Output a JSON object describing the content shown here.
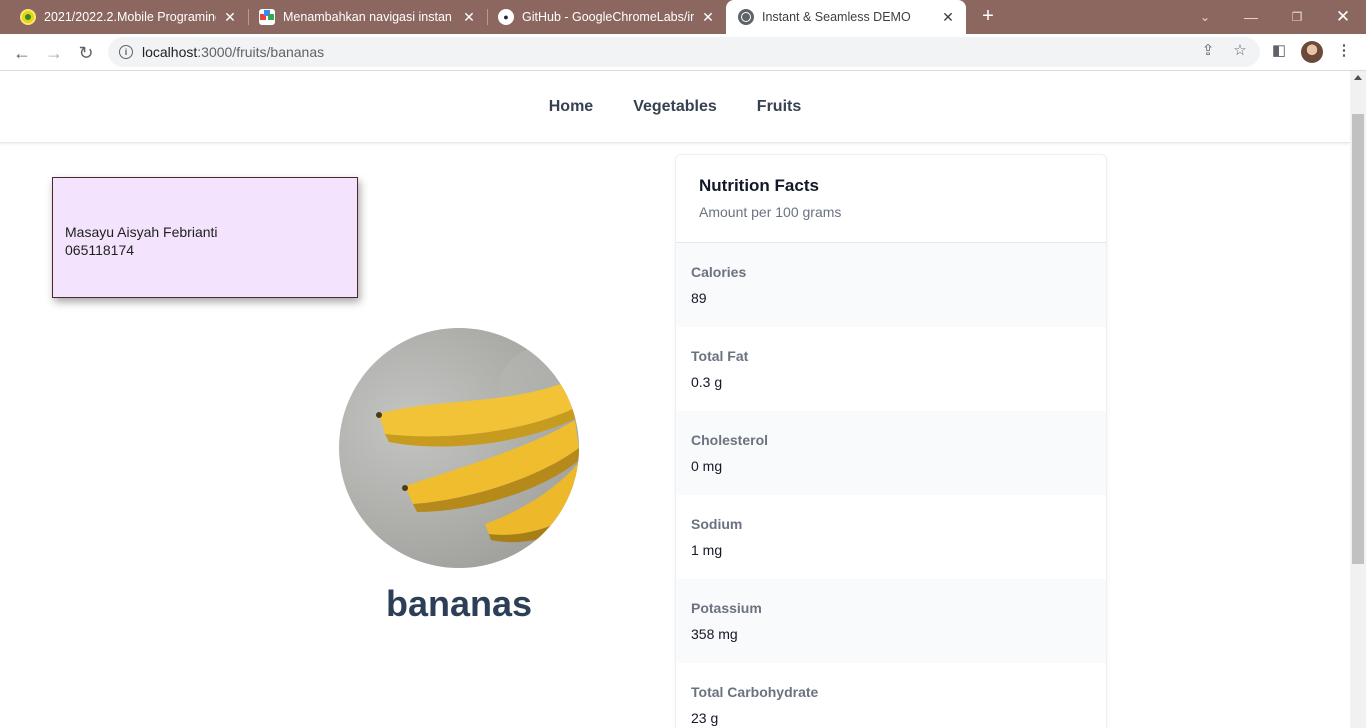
{
  "browser": {
    "tabs": [
      {
        "title": "2021/2022.2.Mobile Programing"
      },
      {
        "title": "Menambahkan navigasi instan da"
      },
      {
        "title": "GitHub - GoogleChromeLabs/inst"
      },
      {
        "title": "Instant & Seamless DEMO",
        "active": true
      }
    ],
    "new_tab_glyph": "+",
    "url_host": "localhost",
    "url_rest": ":3000/fruits/bananas"
  },
  "nav": {
    "items": [
      "Home",
      "Vegetables",
      "Fruits"
    ]
  },
  "note": {
    "name": "Masayu Aisyah Febrianti",
    "id": "065118174"
  },
  "fruit": {
    "name": "bananas",
    "image_icon": "banana-photo"
  },
  "nutrition": {
    "title": "Nutrition Facts",
    "subtitle": "Amount per 100 grams",
    "rows": [
      {
        "label": "Calories",
        "value": "89"
      },
      {
        "label": "Total Fat",
        "value": "0.3 g"
      },
      {
        "label": "Cholesterol",
        "value": "0 mg"
      },
      {
        "label": "Sodium",
        "value": "1 mg"
      },
      {
        "label": "Potassium",
        "value": "358 mg"
      },
      {
        "label": "Total Carbohydrate",
        "value": "23 g"
      }
    ]
  },
  "colors": {
    "tabstrip": "#8b6760",
    "note_bg": "#f3e3fd",
    "title": "#2d3f57"
  }
}
